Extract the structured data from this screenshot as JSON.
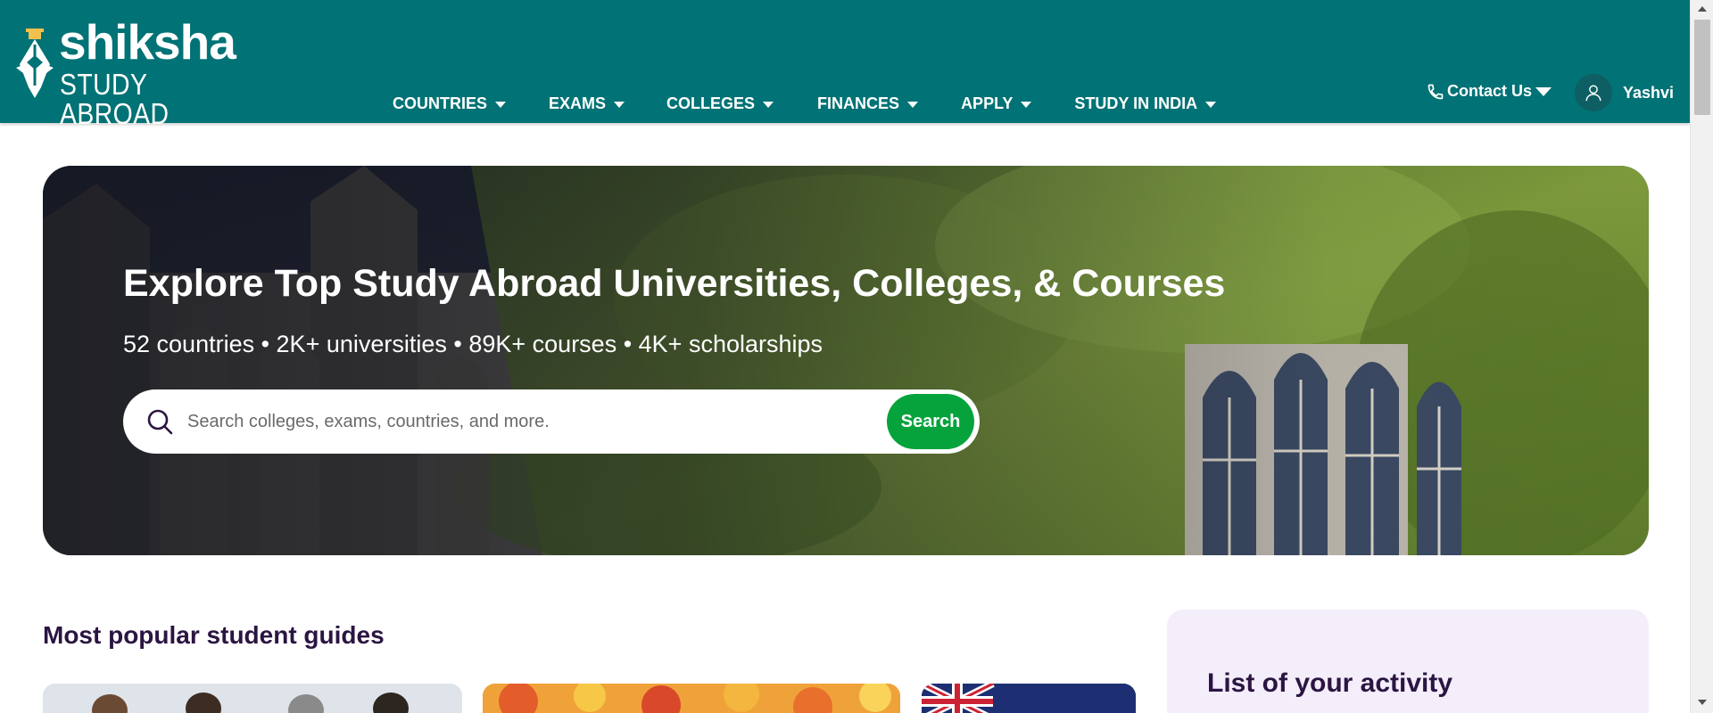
{
  "brand": {
    "name": "shiksha",
    "tagline": "STUDY ABROAD"
  },
  "nav": {
    "items": [
      {
        "label": "COUNTRIES"
      },
      {
        "label": "EXAMS"
      },
      {
        "label": "COLLEGES"
      },
      {
        "label": "FINANCES"
      },
      {
        "label": "APPLY"
      },
      {
        "label": "STUDY IN INDIA"
      }
    ]
  },
  "header": {
    "contact_label": "Contact Us",
    "user_name": "Yashvi"
  },
  "hero": {
    "title": "Explore Top Study Abroad Universities, Colleges, & Courses",
    "stats": "52 countries • 2K+ universities • 89K+ courses • 4K+ scholarships",
    "search_placeholder": "Search colleges, exams, countries, and more.",
    "search_button": "Search"
  },
  "guides": {
    "title": "Most popular student guides"
  },
  "activity": {
    "title": "List of your activity"
  },
  "colors": {
    "header_bg": "#017275",
    "search_button": "#06a33c",
    "heading_text": "#2b1542",
    "activity_bg": "#f4eefb"
  },
  "icons": [
    "pen-nib-icon",
    "chevron-down-icon",
    "phone-icon",
    "user-icon",
    "search-icon"
  ]
}
